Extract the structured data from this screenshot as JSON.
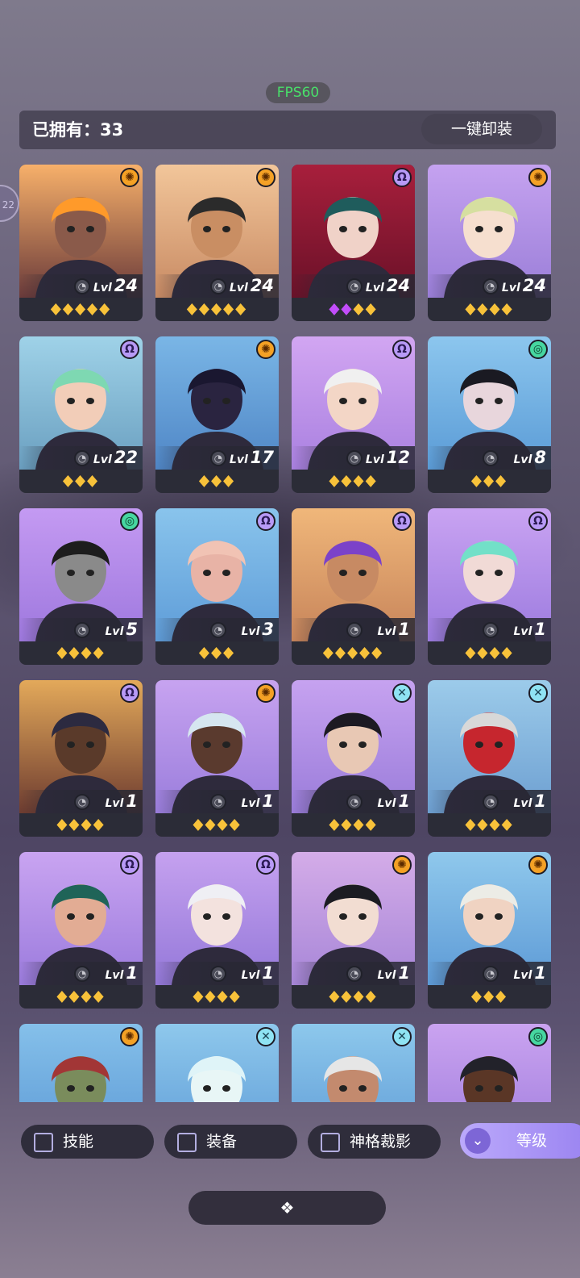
{
  "fps": "FPS60",
  "header": {
    "owned_label": "已拥有：33",
    "unequip_label": "一键卸装"
  },
  "side_tab_text": "22",
  "colors": {
    "accent": "#9b84f1",
    "gold_gem": "#f8c23a",
    "purple_gem": "#c24dfb",
    "card_bg": "#2b2c37",
    "fps_green": "#49e06a"
  },
  "heroes": [
    {
      "level": "24",
      "lvl_label": "Lvl",
      "element": "sun",
      "stars": [
        "gold",
        "gold",
        "gold",
        "gold",
        "gold"
      ],
      "bg": [
        "#f7b06a",
        "#6a3a3a"
      ],
      "skin": "#8a5a4a",
      "hair": "#ff9a2a"
    },
    {
      "level": "24",
      "lvl_label": "Lvl",
      "element": "sun",
      "stars": [
        "gold",
        "gold",
        "gold",
        "gold",
        "gold"
      ],
      "bg": [
        "#f2c69a",
        "#c88a63"
      ],
      "skin": "#c98e63",
      "hair": "#2b2b2b"
    },
    {
      "level": "24",
      "lvl_label": "Lvl",
      "element": "omega",
      "stars": [
        "purple",
        "purple",
        "gold",
        "gold"
      ],
      "bg": [
        "#a81f3c",
        "#6a1128"
      ],
      "skin": "#f0d2c8",
      "hair": "#1f5c5c"
    },
    {
      "level": "24",
      "lvl_label": "Lvl",
      "element": "sun",
      "stars": [
        "gold",
        "gold",
        "gold",
        "gold"
      ],
      "bg": [
        "#c5a2f0",
        "#9a7ed8"
      ],
      "skin": "#f6dfcf",
      "hair": "#d6dfa0"
    },
    {
      "level": "22",
      "lvl_label": "Lvl",
      "element": "omega",
      "stars": [
        "gold",
        "gold",
        "gold"
      ],
      "bg": [
        "#9fd2e8",
        "#6a9fc0"
      ],
      "skin": "#f2cdb8",
      "hair": "#7ed8b2"
    },
    {
      "level": "17",
      "lvl_label": "Lvl",
      "element": "sun",
      "stars": [
        "gold",
        "gold",
        "gold"
      ],
      "bg": [
        "#7ab6e6",
        "#4f86c6"
      ],
      "skin": "#2a2440",
      "hair": "#1a1730"
    },
    {
      "level": "12",
      "lvl_label": "Lvl",
      "element": "omega",
      "stars": [
        "gold",
        "gold",
        "gold",
        "gold"
      ],
      "bg": [
        "#d2a6f2",
        "#a980e0"
      ],
      "skin": "#f3d6c6",
      "hair": "#f0f0f0"
    },
    {
      "level": "8",
      "lvl_label": "Lvl",
      "element": "spiral",
      "stars": [
        "gold",
        "gold",
        "gold"
      ],
      "bg": [
        "#8cc6ee",
        "#5a9bd6"
      ],
      "skin": "#e8d6dc",
      "hair": "#1a1a22"
    },
    {
      "level": "5",
      "lvl_label": "Lvl",
      "element": "spiral",
      "stars": [
        "gold",
        "gold",
        "gold",
        "gold"
      ],
      "bg": [
        "#c49af2",
        "#9e78de"
      ],
      "skin": "#8a8a8a",
      "hair": "#1d1d1d"
    },
    {
      "level": "3",
      "lvl_label": "Lvl",
      "element": "omega",
      "stars": [
        "gold",
        "gold",
        "gold"
      ],
      "bg": [
        "#89c4ec",
        "#5e9cd8"
      ],
      "skin": "#e8b3a6",
      "hair": "#f1c3b4"
    },
    {
      "level": "1",
      "lvl_label": "Lvl",
      "element": "omega",
      "stars": [
        "gold",
        "gold",
        "gold",
        "gold",
        "gold"
      ],
      "bg": [
        "#f0b77a",
        "#c7845a"
      ],
      "skin": "#c78a63",
      "hair": "#7b42c9"
    },
    {
      "level": "1",
      "lvl_label": "Lvl",
      "element": "omega",
      "stars": [
        "gold",
        "gold",
        "gold",
        "gold"
      ],
      "bg": [
        "#c9a3f2",
        "#9c7bdf"
      ],
      "skin": "#f1dad6",
      "hair": "#72e0c8"
    },
    {
      "level": "1",
      "lvl_label": "Lvl",
      "element": "omega",
      "stars": [
        "gold",
        "gold",
        "gold",
        "gold"
      ],
      "bg": [
        "#e3a95a",
        "#6e3c30"
      ],
      "skin": "#5a3a2a",
      "hair": "#2c2a40"
    },
    {
      "level": "1",
      "lvl_label": "Lvl",
      "element": "sun",
      "stars": [
        "gold",
        "gold",
        "gold",
        "gold"
      ],
      "bg": [
        "#c7a3f0",
        "#9a7ddc"
      ],
      "skin": "#5a3a2e",
      "hair": "#d6e6f0"
    },
    {
      "level": "1",
      "lvl_label": "Lvl",
      "element": "cross",
      "stars": [
        "gold",
        "gold",
        "gold",
        "gold"
      ],
      "bg": [
        "#c6a2f0",
        "#9a7cda"
      ],
      "skin": "#e8c8b4",
      "hair": "#1c1a22"
    },
    {
      "level": "1",
      "lvl_label": "Lvl",
      "element": "cross",
      "stars": [
        "gold",
        "gold",
        "gold",
        "gold"
      ],
      "bg": [
        "#9ccbea",
        "#6d9fd1"
      ],
      "skin": "#c6262e",
      "hair": "#d8d8d8"
    },
    {
      "level": "1",
      "lvl_label": "Lvl",
      "element": "omega",
      "stars": [
        "gold",
        "gold",
        "gold",
        "gold"
      ],
      "bg": [
        "#c9a4f1",
        "#9b7bdd"
      ],
      "skin": "#e2ac94",
      "hair": "#1f6458"
    },
    {
      "level": "1",
      "lvl_label": "Lvl",
      "element": "omega",
      "stars": [
        "gold",
        "gold",
        "gold",
        "gold"
      ],
      "bg": [
        "#c5a1ef",
        "#9478d9"
      ],
      "skin": "#f3e2de",
      "hair": "#efeff4"
    },
    {
      "level": "1",
      "lvl_label": "Lvl",
      "element": "sun",
      "stars": [
        "gold",
        "gold",
        "gold",
        "gold"
      ],
      "bg": [
        "#d4ace8",
        "#a786d8"
      ],
      "skin": "#f2ddd2",
      "hair": "#1c1c22"
    },
    {
      "level": "1",
      "lvl_label": "Lvl",
      "element": "sun",
      "stars": [
        "gold",
        "gold",
        "gold"
      ],
      "bg": [
        "#8fc8ec",
        "#5d9ad6"
      ],
      "skin": "#f0d3c2",
      "hair": "#ecece6"
    },
    {
      "level": "",
      "lvl_label": "",
      "element": "sun",
      "stars": [],
      "bg": [
        "#85c0ea",
        "#5a97d4"
      ],
      "skin": "#7a8c5c",
      "hair": "#a23636"
    },
    {
      "level": "",
      "lvl_label": "",
      "element": "cross",
      "stars": [],
      "bg": [
        "#8ec8ec",
        "#5d9ad6"
      ],
      "skin": "#e8f6f6",
      "hair": "#dff4f8"
    },
    {
      "level": "",
      "lvl_label": "",
      "element": "cross",
      "stars": [],
      "bg": [
        "#8dc8ec",
        "#5d99d5"
      ],
      "skin": "#c38a6e",
      "hair": "#e6e6e6"
    },
    {
      "level": "",
      "lvl_label": "",
      "element": "spiral",
      "stars": [],
      "bg": [
        "#caa3f0",
        "#9d7bdc"
      ],
      "skin": "#5a3626",
      "hair": "#22222a"
    }
  ],
  "filters": [
    {
      "label": "技能"
    },
    {
      "label": "装备"
    },
    {
      "label": "神格裁影"
    }
  ],
  "sort": {
    "label": "等级",
    "icon": "double-chevron-down-icon"
  },
  "bottom_button_icon": "diamond-cluster-icon"
}
